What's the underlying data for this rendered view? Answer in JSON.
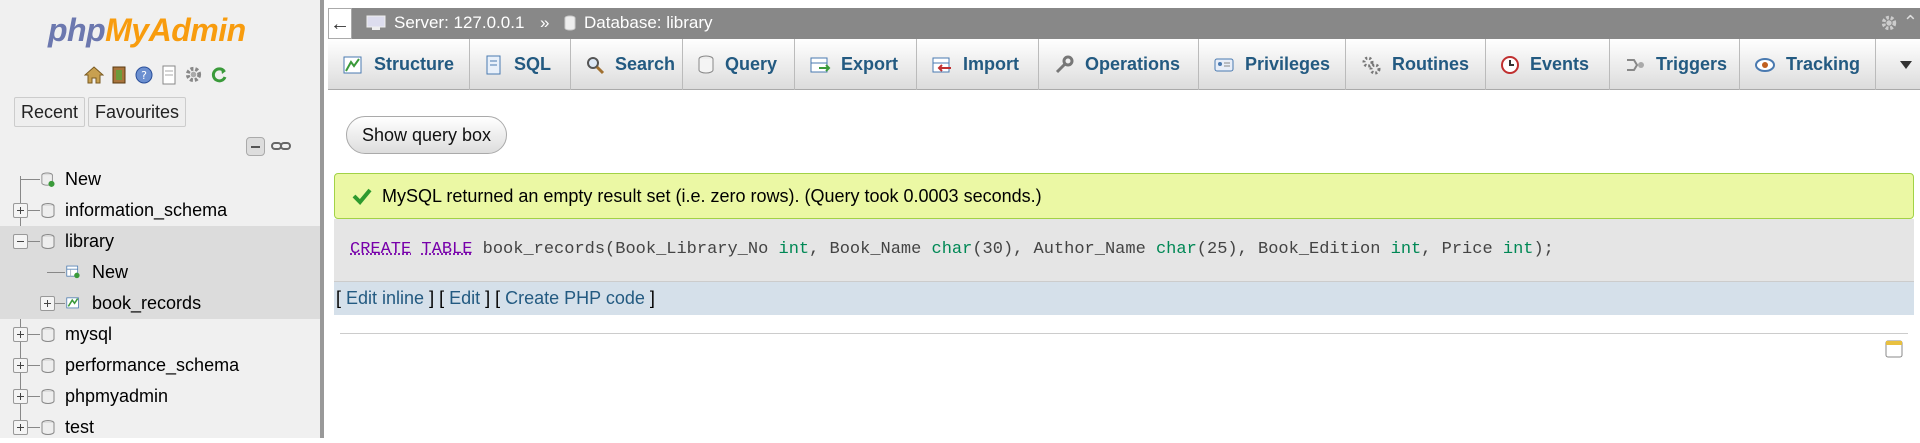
{
  "logo": {
    "php": "php",
    "myadmin": "MyAdmin"
  },
  "nav": {
    "recent_label": "Recent",
    "favourites_label": "Favourites",
    "icons": [
      "home-icon",
      "exit-icon",
      "help-icon",
      "docs-icon",
      "settings-icon",
      "reload-icon"
    ]
  },
  "tree": {
    "items": [
      {
        "label": "New"
      },
      {
        "label": "information_schema"
      },
      {
        "label": "library"
      },
      {
        "label": "New"
      },
      {
        "label": "book_records"
      },
      {
        "label": "mysql"
      },
      {
        "label": "performance_schema"
      },
      {
        "label": "phpmyadmin"
      },
      {
        "label": "test"
      }
    ]
  },
  "breadcrumb": {
    "back": "←",
    "server": "Server: 127.0.0.1",
    "separator": "»",
    "database": "Database: library"
  },
  "tabs": [
    {
      "label": "Structure",
      "icon": "structure-icon"
    },
    {
      "label": "SQL",
      "icon": "sql-icon"
    },
    {
      "label": "Search",
      "icon": "search-icon"
    },
    {
      "label": "Query",
      "icon": "query-icon"
    },
    {
      "label": "Export",
      "icon": "export-icon"
    },
    {
      "label": "Import",
      "icon": "import-icon"
    },
    {
      "label": "Operations",
      "icon": "operations-icon"
    },
    {
      "label": "Privileges",
      "icon": "privileges-icon"
    },
    {
      "label": "Routines",
      "icon": "routines-icon"
    },
    {
      "label": "Events",
      "icon": "events-icon"
    },
    {
      "label": "Triggers",
      "icon": "triggers-icon"
    },
    {
      "label": "Tracking",
      "icon": "tracking-icon"
    }
  ],
  "main": {
    "show_query_label": "Show query box",
    "success_message": "MySQL returned an empty result set (i.e. zero rows). (Query took 0.0003 seconds.)",
    "sql": {
      "kw1": "CREATE",
      "kw2": "TABLE",
      "p1": " book_records(Book_Library_No ",
      "t1": "int",
      "p2": ", Book_Name ",
      "t2": "char",
      "p3": "(30), Author_Name ",
      "t3": "char",
      "p4": "(25), Book_Edition ",
      "t4": "int",
      "p5": ", Price ",
      "t5": "int",
      "p6": ");"
    },
    "actions": {
      "open1": "[ ",
      "edit_inline": "Edit inline",
      "sep1": " ] [ ",
      "edit": "Edit",
      "sep2": " ] [ ",
      "create_php": "Create PHP code",
      "close": " ]"
    }
  },
  "colors": {
    "link": "#235a81",
    "success_bg": "#ebf8a4",
    "topbar_bg": "#888888",
    "logo_php": "#6c78af",
    "logo_myadmin": "#f89c0e"
  }
}
